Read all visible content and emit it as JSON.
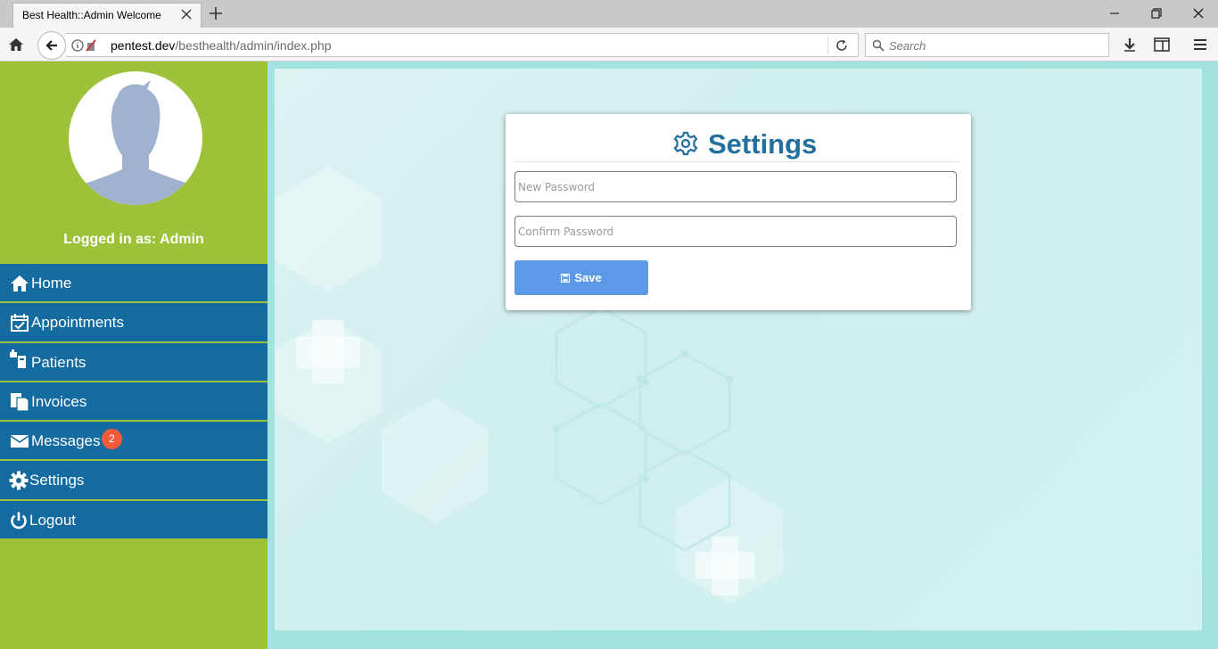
{
  "browser": {
    "tab_title": "Best Health::Admin Welcome",
    "url_host": "pentest.dev",
    "url_path": "/besthealth/admin/index.php",
    "search_placeholder": "Search"
  },
  "sidebar": {
    "logged_in": "Logged in as: Admin",
    "items": [
      {
        "label": "Home",
        "icon": "home-icon"
      },
      {
        "label": "Appointments",
        "icon": "calendar-check-icon"
      },
      {
        "label": "Patients",
        "icon": "patients-icon"
      },
      {
        "label": "Invoices",
        "icon": "invoice-icon"
      },
      {
        "label": "Messages",
        "icon": "envelope-icon",
        "badge": "2"
      },
      {
        "label": "Settings",
        "icon": "gear-icon"
      },
      {
        "label": "Logout",
        "icon": "power-icon"
      }
    ]
  },
  "settings": {
    "title": "Settings",
    "new_password_placeholder": "New Password",
    "confirm_password_placeholder": "Confirm Password",
    "save_label": "Save"
  },
  "colors": {
    "sidebar_bg": "#9dc23a",
    "menu_bg": "#146b9f",
    "title_color": "#236f9d",
    "save_button": "#5c9ae8",
    "badge": "#f25a3b"
  }
}
